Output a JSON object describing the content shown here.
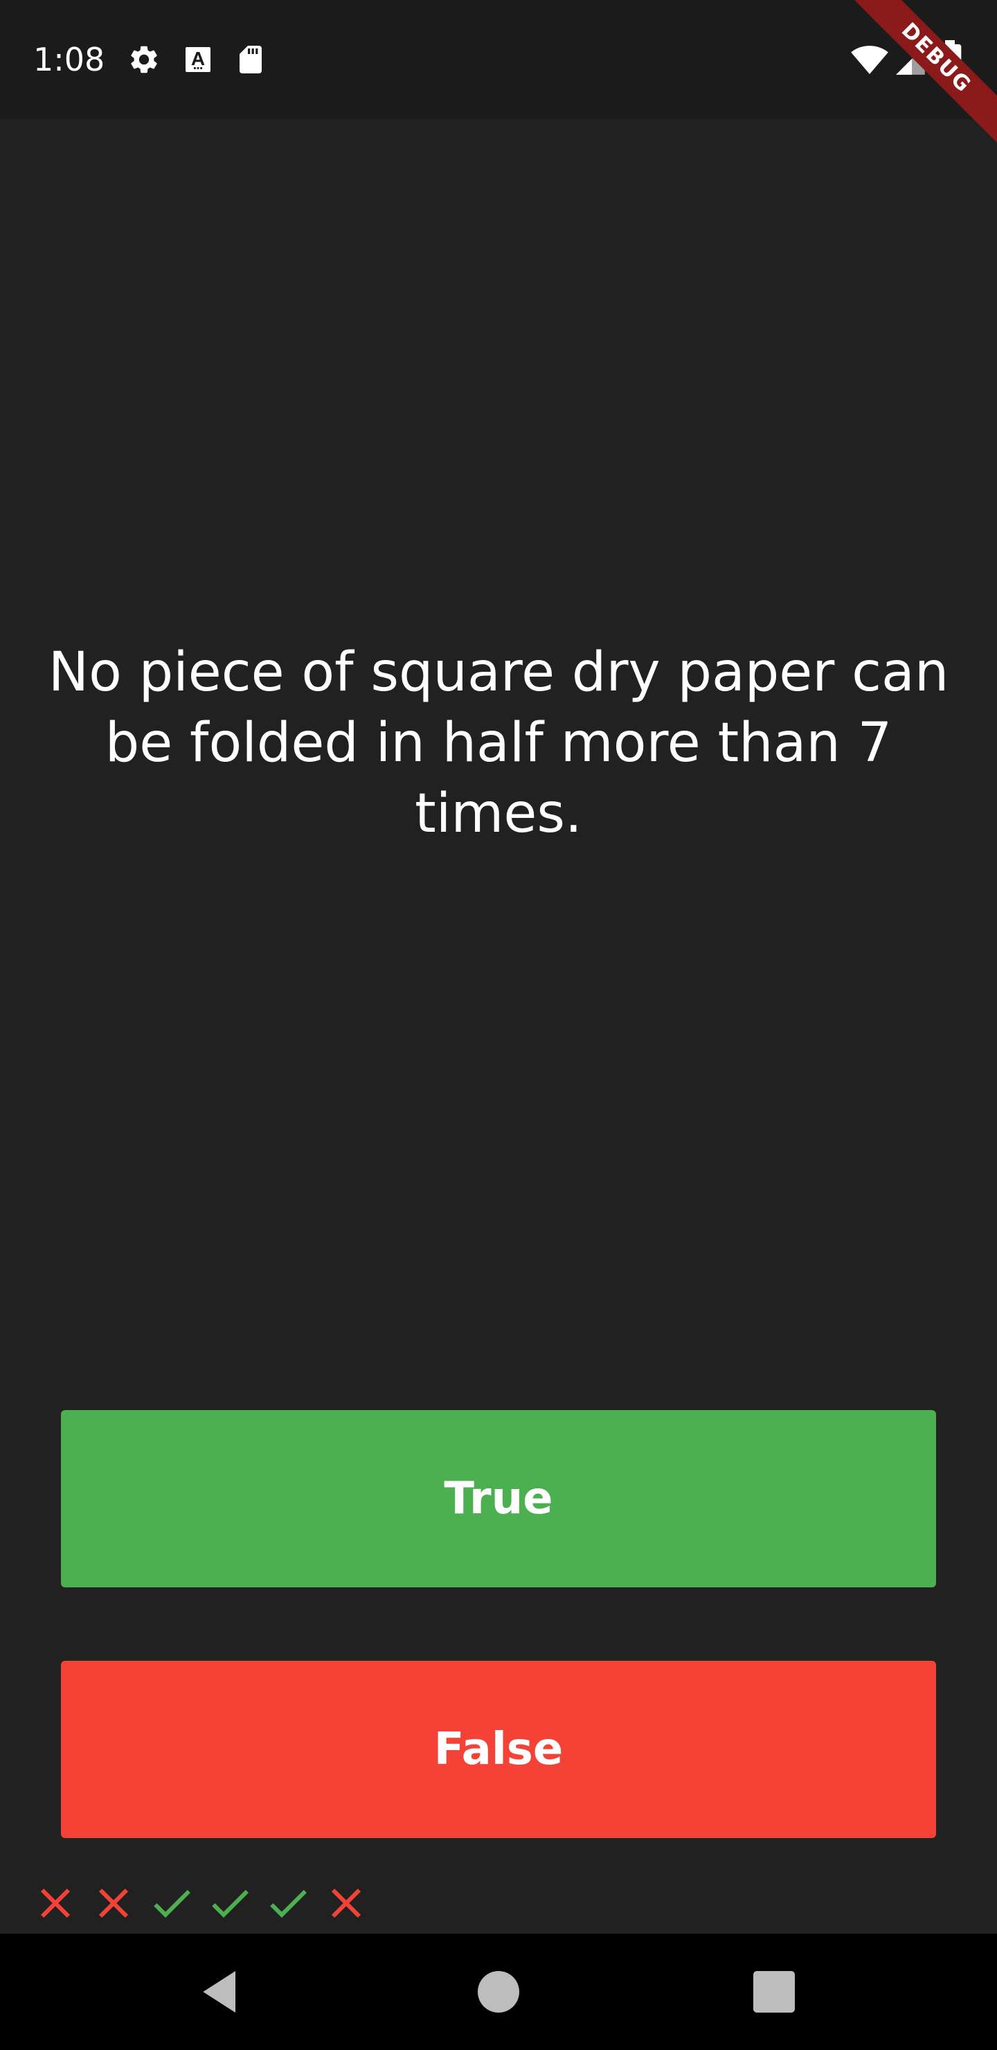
{
  "status_bar": {
    "time": "1:08",
    "left_icons": [
      "gear-icon",
      "font-a-icon",
      "sd-card-icon"
    ],
    "right_icons": [
      "wifi-icon",
      "signal-icon",
      "battery-icon"
    ]
  },
  "debug_banner": {
    "label": "DEBUG",
    "color": "#8b1a1a"
  },
  "question": {
    "text": "No piece of square dry paper can be folded in half more than 7 times."
  },
  "answers": {
    "true_label": "True",
    "true_color": "#4caf50",
    "false_label": "False",
    "false_color": "#f44336"
  },
  "score_keeper": [
    {
      "result": "incorrect",
      "icon": "close-icon",
      "color": "#f44336"
    },
    {
      "result": "incorrect",
      "icon": "close-icon",
      "color": "#f44336"
    },
    {
      "result": "correct",
      "icon": "check-icon",
      "color": "#4caf50"
    },
    {
      "result": "correct",
      "icon": "check-icon",
      "color": "#4caf50"
    },
    {
      "result": "correct",
      "icon": "check-icon",
      "color": "#4caf50"
    },
    {
      "result": "incorrect",
      "icon": "close-icon",
      "color": "#f44336"
    }
  ],
  "nav_bar": {
    "buttons": [
      "back-icon",
      "home-icon",
      "recents-icon"
    ]
  }
}
